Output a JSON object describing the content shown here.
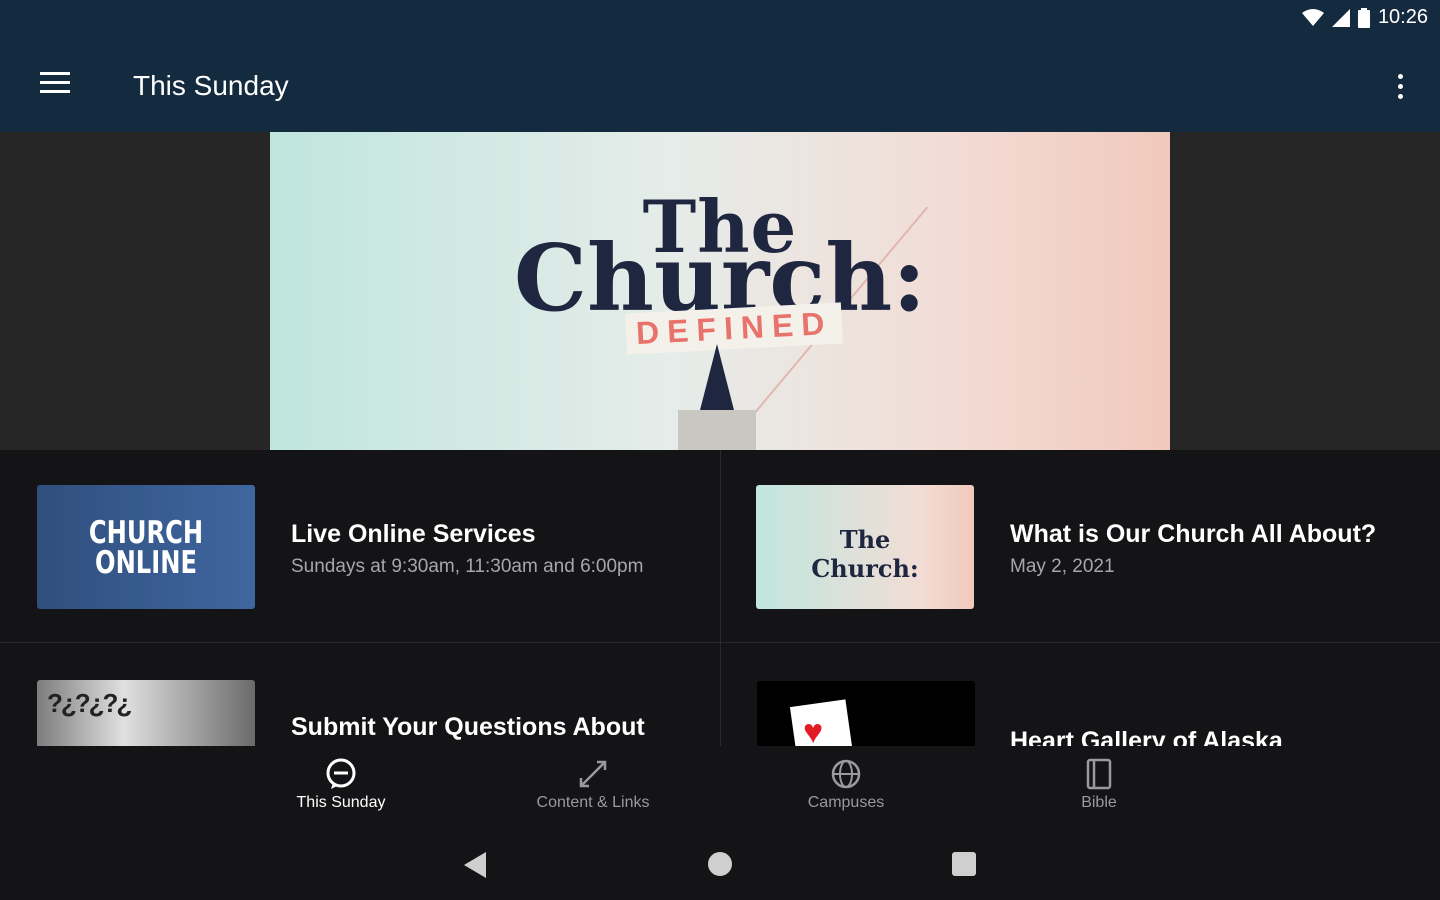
{
  "status_bar": {
    "time": "10:26",
    "wifi_icon": "wifi-icon",
    "signal_icon": "cell-signal-icon",
    "battery_icon": "battery-icon"
  },
  "app_bar": {
    "title": "This Sunday",
    "menu_icon": "hamburger-menu-icon",
    "overflow_icon": "more-vert-icon"
  },
  "hero": {
    "line1": "The",
    "line2": "Church:",
    "line3": "DEFINED"
  },
  "cards": [
    {
      "title": "Live Online Services",
      "subtitle": "Sundays at 9:30am, 11:30am and 6:00pm",
      "thumb_text": "CHURCH\nONLINE"
    },
    {
      "title": "What is Our Church All About?",
      "subtitle": "May 2, 2021",
      "thumb_text": "The\nChurch:"
    },
    {
      "title": "Submit Your Questions About",
      "subtitle": "",
      "thumb_text": "?¿?¿?¿"
    },
    {
      "title": "Heart Gallery of Alaska",
      "subtitle": "",
      "thumb_text": ""
    }
  ],
  "bottom_nav": [
    {
      "label": "This Sunday",
      "icon": "chat-bubble-icon",
      "active": true
    },
    {
      "label": "Content & Links",
      "icon": "collapse-arrows-icon",
      "active": false
    },
    {
      "label": "Campuses",
      "icon": "globe-icon",
      "active": false
    },
    {
      "label": "Bible",
      "icon": "book-icon",
      "active": false
    }
  ],
  "system_nav": {
    "back": "back-icon",
    "home": "home-icon",
    "recents": "recents-icon"
  },
  "colors": {
    "app_bar": "#142a3e",
    "background": "#141416",
    "hero_side": "#262626",
    "accent_text": "#e8736b"
  }
}
